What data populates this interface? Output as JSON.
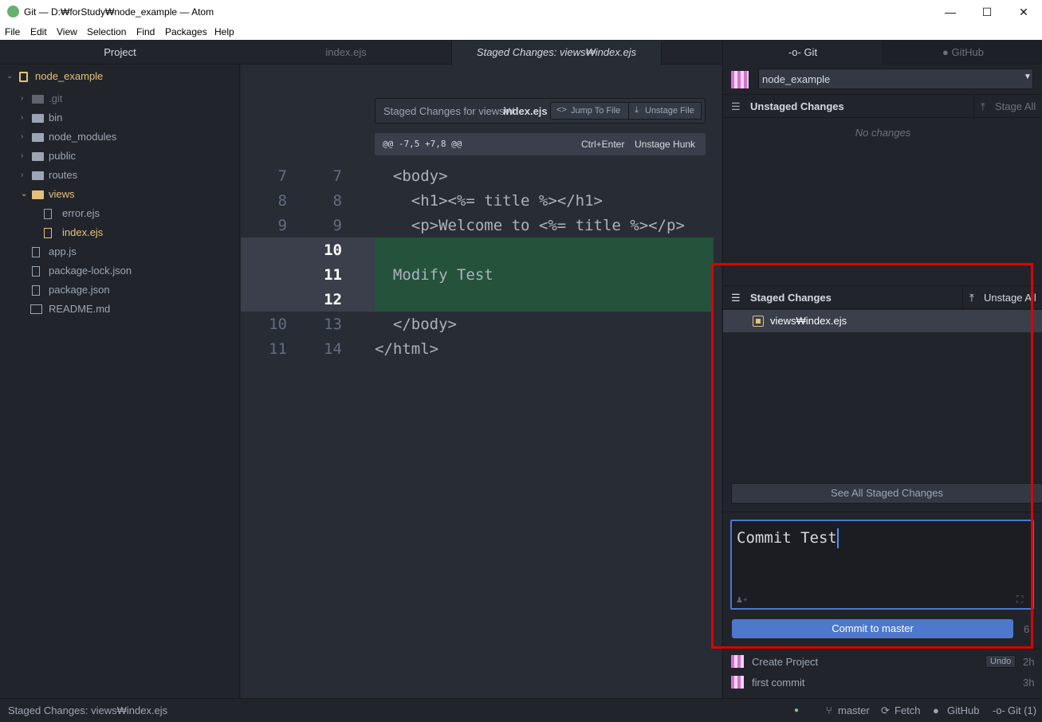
{
  "window": {
    "title": "Git — D:₩forStudy₩node_example — Atom",
    "minimize": "—",
    "maximize": "☐",
    "close": "✕"
  },
  "menu": [
    "File",
    "Edit",
    "View",
    "Selection",
    "Find",
    "Packages",
    "Help"
  ],
  "tree": {
    "header": "Project",
    "root": "node_example",
    "items": [
      ".git",
      "bin",
      "node_modules",
      "public",
      "routes",
      "views",
      "error.ejs",
      "index.ejs",
      "app.js",
      "package-lock.json",
      "package.json",
      "README.md"
    ]
  },
  "tabs": {
    "tab1": "index.ejs",
    "tab2": "Staged Changes: views₩index.ejs"
  },
  "diff": {
    "header_label": "Staged Changes for views₩",
    "header_file": "index.ejs",
    "jump_label": "Jump To File",
    "unstage_file_label": "Unstage File",
    "hunk": "@@ -7,5 +7,8 @@",
    "shortcut": "Ctrl+Enter",
    "unstage_hunk": "Unstage Hunk",
    "lines": [
      {
        "old": "7",
        "new": "7",
        "text": "  <body>"
      },
      {
        "old": "8",
        "new": "8",
        "text": "    <h1><%= title %></h1>"
      },
      {
        "old": "9",
        "new": "9",
        "text": "    <p>Welcome to <%= title %></p>"
      },
      {
        "old": "",
        "new": "10",
        "text": ""
      },
      {
        "old": "",
        "new": "11",
        "text": "  Modify Test"
      },
      {
        "old": "",
        "new": "12",
        "text": ""
      },
      {
        "old": "10",
        "new": "13",
        "text": "  </body>"
      },
      {
        "old": "11",
        "new": "14",
        "text": "</html>"
      }
    ],
    "added_color": "#24523b"
  },
  "git": {
    "tab_git": "Git",
    "tab_github": "GitHub",
    "repo": "node_example",
    "unstaged_title": "Unstaged Changes",
    "stage_all": "Stage All",
    "no_changes": "No changes",
    "staged_title": "Staged Changes",
    "unstage_all": "Unstage All",
    "staged_file": "views₩index.ejs",
    "see_all": "See All Staged Changes",
    "commit_message": "Commit Test",
    "commit_button": "Commit to master",
    "char_count": "6",
    "commits": [
      {
        "msg": "Create Project",
        "time": "2h",
        "undo": "Undo"
      },
      {
        "msg": "first commit",
        "time": "3h"
      }
    ],
    "accent": "#4d78cc"
  },
  "status": {
    "left": "Staged Changes: views₩index.ejs",
    "branch": "master",
    "fetch": "Fetch",
    "github": "GitHub",
    "git": "Git (1)"
  },
  "highlight_color": "#e00000"
}
